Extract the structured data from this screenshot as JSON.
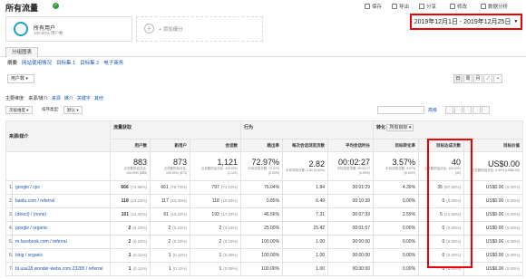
{
  "header": {
    "title": "所有流量"
  },
  "toolbar": [
    {
      "label": "保存"
    },
    {
      "label": "导出"
    },
    {
      "label": "分享"
    },
    {
      "label": "修改"
    },
    {
      "label": "数据分析"
    }
  ],
  "segment": {
    "name": "所有用户",
    "sub": "100.00% 用户数"
  },
  "add_segment": "+ 添加细分",
  "date_range": "2019年12月1日 - 2019年12月25日",
  "tabs": {
    "active": "分组图表"
  },
  "subnav": [
    "摘要",
    "网站使用情况",
    "目标集 1",
    "目标集 2",
    "电子商务"
  ],
  "metric_select": "用户数",
  "dimensions": {
    "label": "主要维度:",
    "active": "来源/媒介",
    "links": [
      "来源",
      "媒介",
      "关键字",
      "其他"
    ]
  },
  "controls": {
    "secondary": "次级维度",
    "sort_label": "排序类型:",
    "sort_value": "默认",
    "advanced": "高级"
  },
  "table": {
    "dim_header": "来源/媒介",
    "group_headers": [
      "流量获取",
      "行为",
      "转化",
      "所有目标"
    ],
    "columns": [
      "用户数",
      "新用户",
      "会话数",
      "跳出率",
      "每次会话浏览页数",
      "平均会话时长",
      "目标转化率",
      "目标达成次数",
      "目标价值"
    ],
    "totals": [
      {
        "big": "883",
        "sm": "占总数的百分比: 100.00% (883)"
      },
      {
        "big": "873",
        "sm": "占总数的百分比: 100.00% (873)"
      },
      {
        "big": "1,121",
        "sm": "占总数的百分比: 100.00% (1,121)"
      },
      {
        "big": "72.97%",
        "sm": "平均浏览次数: 72.97% (0.00%)"
      },
      {
        "big": "2.82",
        "sm": "平均浏览次数: 2.82 (0.00%)"
      },
      {
        "big": "00:02:27",
        "sm": "平均浏览次数: 00:02:27 (0.00%)"
      },
      {
        "big": "3.57%",
        "sm": "平均浏览次数: 3.57% (0.00%)"
      },
      {
        "big": "40",
        "sm": "占总数的百分比: 100.00% (40)"
      },
      {
        "big": "US$0.00",
        "sm": "占总数的百分比: 0.00% (US$0.00)"
      }
    ],
    "rows": [
      {
        "idx": "1.",
        "name": "google / cpc",
        "users": "666",
        "users_pct": "(74.66%)",
        "new": "661",
        "new_pct": "(75.72%)",
        "sessions": "797",
        "sessions_pct": "(71.10%)",
        "bounce": "76.04%",
        "pages": "1.84",
        "duration": "00:01:29",
        "conv": "4.39%",
        "goals": "35",
        "goals_pct": "(87.50%)",
        "value": "US$0.00",
        "value_pct": "(0.00%)"
      },
      {
        "idx": "2.",
        "name": "baidu.com / referral",
        "users": "118",
        "users_pct": "(13.23%)",
        "new": "117",
        "new_pct": "(13.40%)",
        "sessions": "118",
        "sessions_pct": "(10.53%)",
        "bounce": "0.85%",
        "pages": "6.49",
        "duration": "00:10:39",
        "conv": "0.00%",
        "goals": "0",
        "goals_pct": "(0.00%)",
        "value": "US$0.00",
        "value_pct": "(0.00%)"
      },
      {
        "idx": "3.",
        "name": "(direct) / (none)",
        "users": "101",
        "users_pct": "(11.32%)",
        "new": "91",
        "new_pct": "(10.42%)",
        "sessions": "193",
        "sessions_pct": "(17.22%)",
        "bounce": "46.56%",
        "pages": "7.31",
        "duration": "00:07:33",
        "conv": "2.59%",
        "goals": "5",
        "goals_pct": "(12.50%)",
        "value": "US$0.00",
        "value_pct": "(0.00%)"
      },
      {
        "idx": "4.",
        "name": "google / organic",
        "users": "2",
        "users_pct": "(0.22%)",
        "new": "2",
        "new_pct": "(0.23%)",
        "sessions": "2",
        "sessions_pct": "(0.18%)",
        "bounce": "25.00%",
        "pages": "15.42",
        "duration": "00:01:57",
        "conv": "0.00%",
        "goals": "0",
        "goals_pct": "(0.00%)",
        "value": "US$0.00",
        "value_pct": "(0.00%)"
      },
      {
        "idx": "5.",
        "name": "m.facebook.com / referral",
        "users": "2",
        "users_pct": "(0.22%)",
        "new": "2",
        "new_pct": "(0.23%)",
        "sessions": "2",
        "sessions_pct": "(0.18%)",
        "bounce": "100.00%",
        "pages": "1.00",
        "duration": "00:00:00",
        "conv": "0.00%",
        "goals": "0",
        "goals_pct": "(0.00%)",
        "value": "US$0.00",
        "value_pct": "(0.00%)"
      },
      {
        "idx": "6.",
        "name": "bing / organic",
        "users": "1",
        "users_pct": "(0.11%)",
        "new": "1",
        "new_pct": "(0.11%)",
        "sessions": "1",
        "sessions_pct": "(0.09%)",
        "bounce": "100.00%",
        "pages": "1.00",
        "duration": "00:00:00",
        "conv": "0.00%",
        "goals": "0",
        "goals_pct": "(0.00%)",
        "value": "US$0.00",
        "value_pct": "(0.00%)"
      },
      {
        "idx": "7.",
        "name": "bt.usa18.wonder-webs.com.23285 / referral",
        "users": "1",
        "users_pct": "(0.11%)",
        "new": "1",
        "new_pct": "(0.11%)",
        "sessions": "1",
        "sessions_pct": "(0.09%)",
        "bounce": "100.00%",
        "pages": "1.00",
        "duration": "00:00:00",
        "conv": "0.00%",
        "goals": "0",
        "goals_pct": "(0.00%)",
        "value": "US$0.00",
        "value_pct": "(0.00%)"
      }
    ]
  }
}
